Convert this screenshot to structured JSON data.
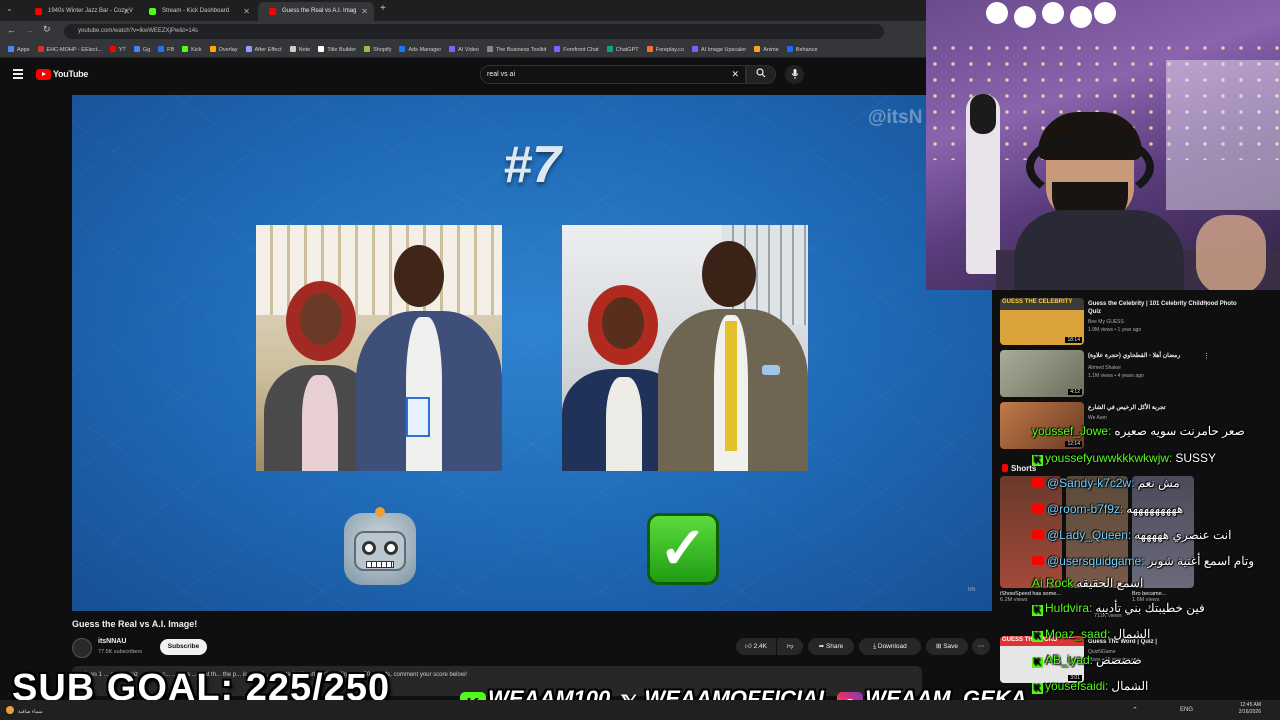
{
  "browser": {
    "tabs": [
      {
        "label": "1940s Winter Jazz Bar - Cozy V",
        "color": "#ff0000"
      },
      {
        "label": "Stream - Kick Dashboard",
        "color": "#53fc18"
      },
      {
        "label": "Guess the Real vs A.I. Imag",
        "color": "#ff0000"
      }
    ],
    "new_tab": "+",
    "url": "youtube.com/watch?v=lkwWEEZXjPw&t=14s",
    "bookmarks": [
      "Apps",
      "EHC-MOHP - EElect...",
      "YT",
      "Gg",
      "FB",
      "Kick",
      "Overlay",
      "After Effect",
      "Note",
      "Title Builder",
      "Shopify",
      "Ads Manager",
      "AI Video",
      "The Business Toolkit",
      "Forefront Chat",
      "ChatGPT",
      "Foreplay.co",
      "AI Image Upscaler",
      "Anime",
      "Behance"
    ]
  },
  "youtube": {
    "logo": "YouTube",
    "search_value": "real vs ai",
    "video": {
      "number": "#7",
      "watermark": "@itsN",
      "corner": "NN"
    },
    "title": "Guess the Real vs A.I. Image!",
    "channel": "itsNNAU",
    "subscribers": "77.5K subscribers",
    "subscribe": "Subscribe",
    "likes": "2.4K",
    "share": "Share",
    "download": "Download",
    "save": "Save",
    "description": "views  1 ... ago   ...quiz ...al you c...  ...gues ...what th... the p...  is a real ...enerated with artificial intelligence. 30 rounds, comment your score below!"
  },
  "sidebar": {
    "suggestions": [
      {
        "title": "Guess the Celebrity | 101 Celebrity Childhood Photo Quiz",
        "channel": "Bee My GUESS",
        "meta": "1.9M views • 1 year ago",
        "duration": "18:14",
        "color": "#d9a23a"
      },
      {
        "title": "رمضان أهلا - القطحاوي (حجرة علاوة)",
        "channel": "Ahmed Shaker",
        "meta": "1.1M views • 4 years ago",
        "duration": "4:12",
        "color": "#8a8f7a"
      },
      {
        "title": "تجربة الأكل الرخيص في الشارع",
        "channel": "We Aam",
        "meta": "",
        "duration": "12:14",
        "color": "#b36a3a"
      }
    ],
    "shorts_label": "Shorts",
    "shorts": [
      {
        "title": "iShowSpeed has some...",
        "views": "6.2M views",
        "color": "#a4493a"
      },
      {
        "title": "...",
        "views": "711K views",
        "color": "#7a5a4a"
      },
      {
        "title": "Bro became...",
        "views": "1.6M views",
        "color": "#6a6a7a"
      }
    ],
    "last": {
      "title": "Guess The Word | Quiz |",
      "channel": "QuizNGame",
      "meta": "views • 16 minutes ago",
      "duration": "3:01",
      "badge": "GUESS THE WORD"
    }
  },
  "chat": [
    {
      "platform": "none",
      "user": "youssef_Jowe:",
      "msg": "صعر حامرنت سويه صعيره"
    },
    {
      "platform": "kick",
      "user": "youssefyuwwkkkwkwjw:",
      "msg": "SUSSY"
    },
    {
      "platform": "youtube",
      "user": "@Sandy-k7c2w:",
      "msg": "مش نعم"
    },
    {
      "platform": "youtube",
      "user": "@room-b7f9z:",
      "msg": "هههههههههه"
    },
    {
      "platform": "youtube",
      "user": "@Lady_Queen:",
      "msg": "انت عنصري هههههه"
    },
    {
      "platform": "youtube",
      "user": "@usersquidgame:",
      "msg": "وتام اسمع أغنية شوبر"
    },
    {
      "platform": "none",
      "user": "Ai Rock",
      "msg": "اسمع الحقيقه"
    },
    {
      "platform": "kick",
      "user": "Huldvira:",
      "msg": "فين خطيبتك بني تأديبه"
    },
    {
      "platform": "kick",
      "user": "Moaz_saad:",
      "msg": "الشمال"
    },
    {
      "platform": "kick",
      "user": "AB_iyad:",
      "msg": "ضضضض"
    },
    {
      "platform": "kick",
      "user": "yousefsaidi:",
      "msg": "الشمال"
    }
  ],
  "overlay": {
    "sub_goal": "SUB GOAL: 225/250",
    "kick_handle": "WEAAM100",
    "x_handle": "WEAAMOFFICIAL",
    "ig_handle": "WEAAM_GEKA"
  },
  "taskbar": {
    "lang": "ENG",
    "time": "12:45 AM",
    "date": "2/16/2026",
    "weather": "سماء صافية"
  },
  "colors": {
    "kick_green": "#53fc18",
    "yt_red": "#ff0000",
    "video_blue": "#2f83d0"
  }
}
